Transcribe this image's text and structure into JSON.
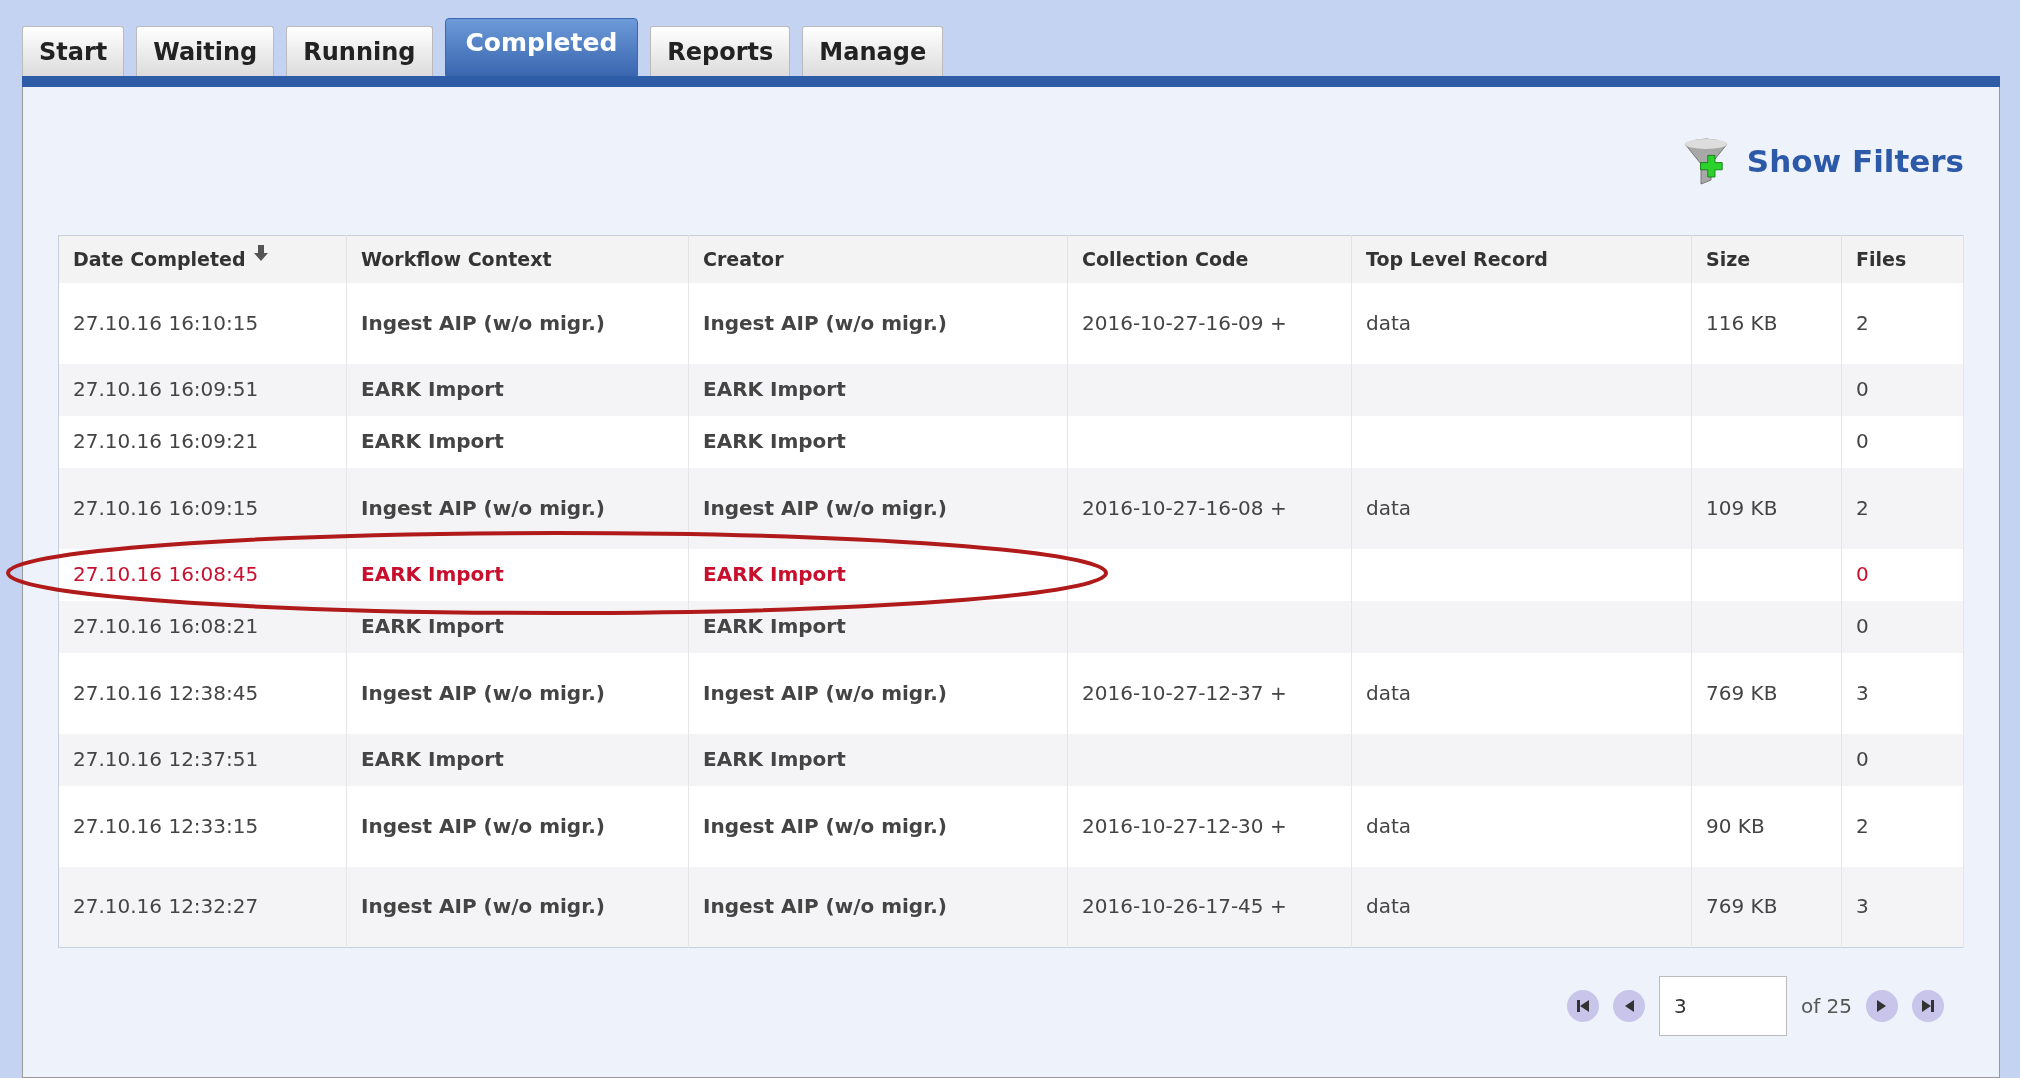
{
  "tabs": [
    {
      "label": "Start",
      "selected": false
    },
    {
      "label": "Waiting",
      "selected": false
    },
    {
      "label": "Running",
      "selected": false
    },
    {
      "label": "Completed",
      "selected": true
    },
    {
      "label": "Reports",
      "selected": false
    },
    {
      "label": "Manage",
      "selected": false
    }
  ],
  "filters_link": "Show Filters",
  "table": {
    "columns": [
      {
        "label": "Date Completed",
        "sorted": true
      },
      {
        "label": "Workflow Context",
        "sorted": false
      },
      {
        "label": "Creator",
        "sorted": false
      },
      {
        "label": "Collection Code",
        "sorted": false
      },
      {
        "label": "Top Level Record",
        "sorted": false
      },
      {
        "label": "Size",
        "sorted": false
      },
      {
        "label": "Files",
        "sorted": false
      }
    ],
    "rows": [
      {
        "highlighted": false,
        "cells": [
          "27.10.16 16:10:15",
          "Ingest AIP (w/o migr.)",
          "Ingest AIP (w/o migr.)",
          "2016-10-27-16-09 +",
          "data",
          "116 KB",
          "2"
        ]
      },
      {
        "highlighted": false,
        "cells": [
          "27.10.16 16:09:51",
          "EARK Import",
          "EARK Import",
          "",
          "",
          "",
          "0"
        ]
      },
      {
        "highlighted": false,
        "cells": [
          "27.10.16 16:09:21",
          "EARK Import",
          "EARK Import",
          "",
          "",
          "",
          "0"
        ]
      },
      {
        "highlighted": false,
        "cells": [
          "27.10.16 16:09:15",
          "Ingest AIP (w/o migr.)",
          "Ingest AIP (w/o migr.)",
          "2016-10-27-16-08 +",
          "data",
          "109 KB",
          "2"
        ]
      },
      {
        "highlighted": true,
        "cells": [
          "27.10.16 16:08:45",
          "EARK Import",
          "EARK Import",
          "",
          "",
          "",
          "0"
        ]
      },
      {
        "highlighted": false,
        "cells": [
          "27.10.16 16:08:21",
          "EARK Import",
          "EARK Import",
          "",
          "",
          "",
          "0"
        ]
      },
      {
        "highlighted": false,
        "cells": [
          "27.10.16 12:38:45",
          "Ingest AIP (w/o migr.)",
          "Ingest AIP (w/o migr.)",
          "2016-10-27-12-37 +",
          "data",
          "769 KB",
          "3"
        ]
      },
      {
        "highlighted": false,
        "cells": [
          "27.10.16 12:37:51",
          "EARK Import",
          "EARK Import",
          "",
          "",
          "",
          "0"
        ]
      },
      {
        "highlighted": false,
        "cells": [
          "27.10.16 12:33:15",
          "Ingest AIP (w/o migr.)",
          "Ingest AIP (w/o migr.)",
          "2016-10-27-12-30 +",
          "data",
          "90 KB",
          "2"
        ]
      },
      {
        "highlighted": false,
        "cells": [
          "27.10.16 12:32:27",
          "Ingest AIP (w/o migr.)",
          "Ingest AIP (w/o migr.)",
          "2016-10-26-17-45 +",
          "data",
          "769 KB",
          "3"
        ]
      }
    ]
  },
  "pager": {
    "page": "3",
    "of": "of 25"
  }
}
